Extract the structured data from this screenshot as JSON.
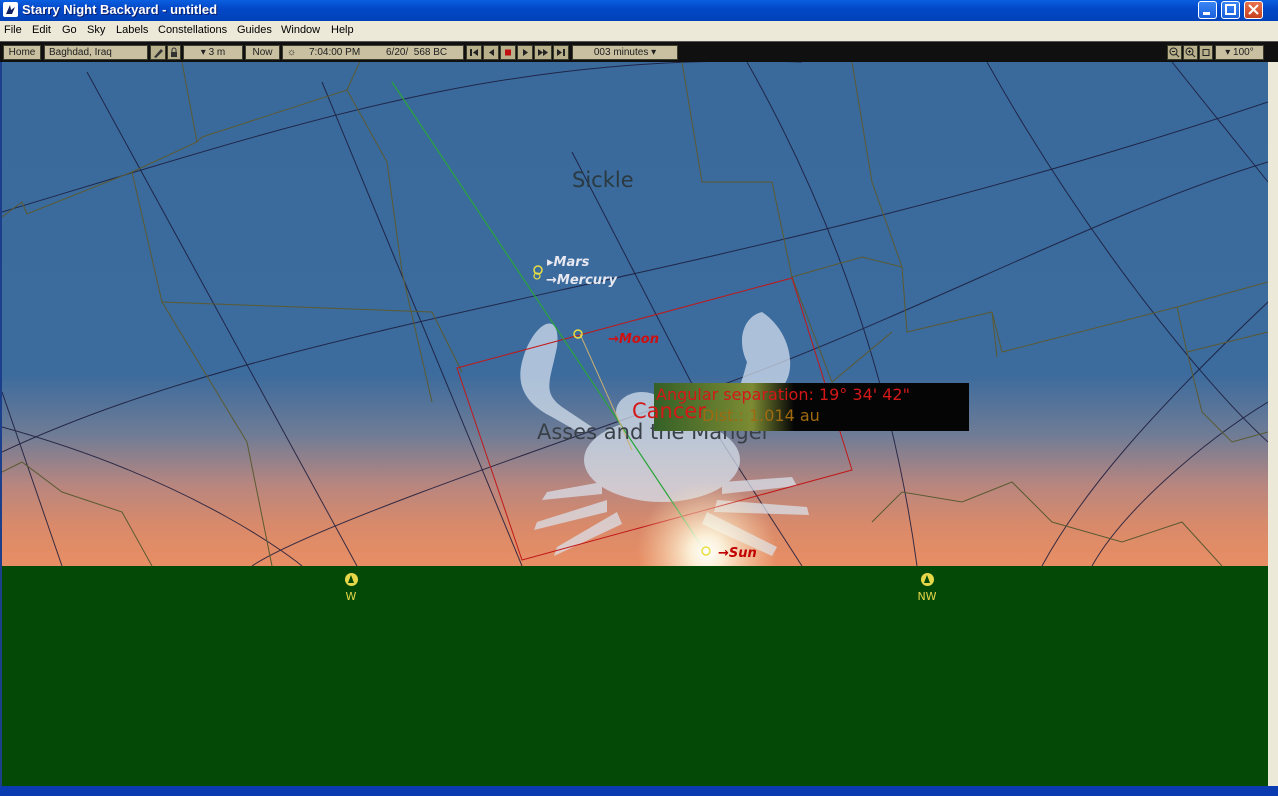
{
  "window": {
    "title": "Starry Night Backyard - untitled",
    "icon": "starry-night-app-icon"
  },
  "menu": [
    "File",
    "Edit",
    "Go",
    "Sky",
    "Labels",
    "Constellations",
    "Guides",
    "Window",
    "Help"
  ],
  "toolbar": {
    "home_label": "Home",
    "location": "Baghdad, Iraq",
    "elevation": "▾ 3 m",
    "now_label": "Now",
    "time": "7:04:00 PM",
    "date": "6/20/  568 BC",
    "time_step": "003 minutes ▾",
    "field_of_view": "▾ 100°"
  },
  "sky": {
    "constellations": {
      "sickle": "Sickle",
      "cancer": "Cancer",
      "asses": "Asses and the Manger"
    },
    "planets": {
      "mars": "Mars",
      "mercury": "Mercury",
      "moon": "Moon",
      "sun": "Sun"
    },
    "info_box": {
      "angular_separation": "Angular separation: 19° 34' 42\"",
      "distance": "Dist.: 1.014 au"
    }
  },
  "compass": {
    "west": "W",
    "northwest": "NW"
  },
  "colors": {
    "sky_top": "#3a6a9c",
    "horizon_glow": "#e88e64",
    "ground": "#044a06",
    "planet_label": "#e8e8f0",
    "moon_label": "#d01010",
    "sun_label": "#c00000",
    "compass_marker": "#e6d84a"
  }
}
